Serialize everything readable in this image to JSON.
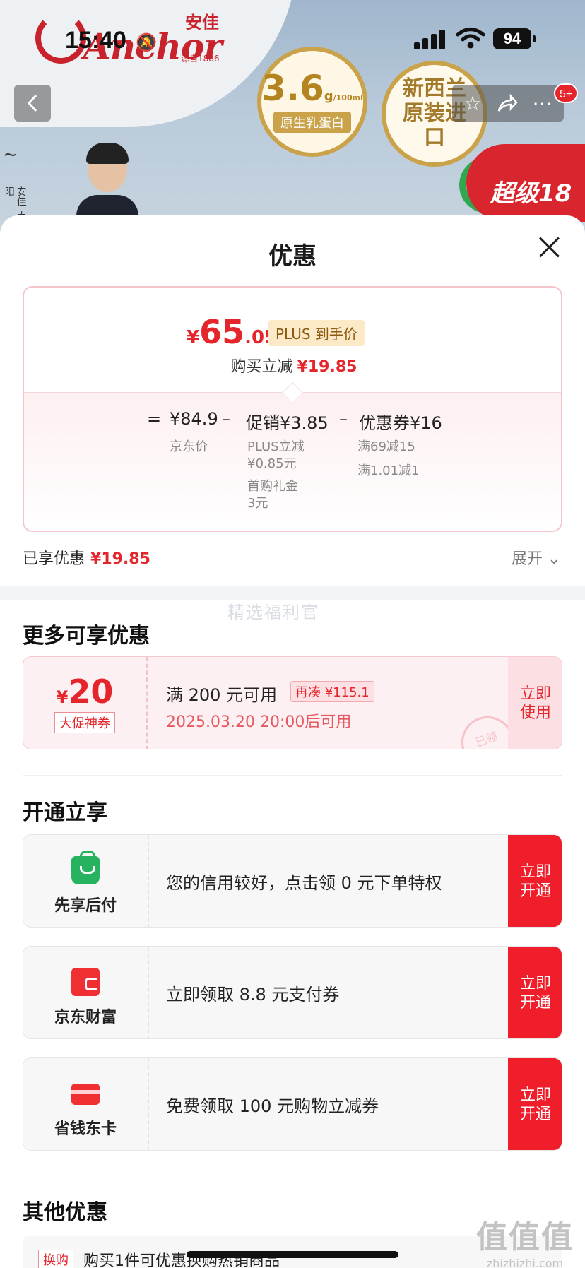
{
  "status": {
    "time": "15:40",
    "battery": "94"
  },
  "banner": {
    "brand_word": "Anchor",
    "brand_cn": "安佳",
    "brand_since": "源自1886",
    "protein_value": "3.6",
    "protein_unit": "g",
    "protein_sub": "/100ml",
    "protein_label": "原生乳蛋白",
    "origin_label": "新西兰原装进口",
    "red_badge": "超级18",
    "signature_text": "安佳 王阳"
  },
  "nav": {
    "back_icon": "chevron-left-icon",
    "notif_count": "5+"
  },
  "sheet": {
    "title": "优惠",
    "final_price_symbol": "¥",
    "final_price_int": "65",
    "final_price_dec": ".05",
    "plus_tag": "PLUS 到手价",
    "instant_label": "购买立减",
    "instant_value": "¥19.85",
    "formula": {
      "equals": "=",
      "jd_price": "¥84.9",
      "minus1": "–",
      "promo": "促销¥3.85",
      "minus2": "–",
      "coupon": "优惠券¥16",
      "jd_price_label": "京东价",
      "promo_detail_1": "PLUS立减",
      "promo_detail_1_value": "¥0.85元",
      "promo_detail_2": "首购礼金",
      "promo_detail_2_value": "3元",
      "coupon_detail_1": "满69减15",
      "coupon_detail_2": "满1.01减1"
    },
    "enjoyed_label": "已享优惠",
    "enjoyed_value": "¥19.85",
    "expand_label": "展开 ⌄",
    "watermark": "精选福利官"
  },
  "more_offers": {
    "title": "更多可享优惠",
    "coupon": {
      "symbol": "¥",
      "amount": "20",
      "tag": "大促神券",
      "condition": "满 200 元可用",
      "add_more": "再凑 ¥115.1",
      "valid_from": "2025.03.20 20:00后可用",
      "action": "立即使用",
      "stamp": "已领"
    }
  },
  "activate": {
    "title": "开通立享",
    "items": [
      {
        "name": "先享后付",
        "icon": "shopping-bag-icon",
        "desc": "您的信用较好，点击领 0 元下单特权",
        "action": "立即开通"
      },
      {
        "name": "京东财富",
        "icon": "wallet-icon",
        "desc": "立即领取 8.8 元支付券",
        "action": "立即开通"
      },
      {
        "name": "省钱东卡",
        "icon": "card-icon",
        "desc": "免费领取 100 元购物立减券",
        "action": "立即开通"
      }
    ]
  },
  "other": {
    "title": "其他优惠",
    "row_tag": "换购",
    "row_text": "购买1件可优惠换购热销商品"
  },
  "site_watermark": {
    "glyphs": "值值值",
    "url": "zhizhizhi.com"
  },
  "colors": {
    "accent": "#e4262c",
    "cta": "#f01e2a",
    "plus_bg": "#fbe9c7"
  }
}
